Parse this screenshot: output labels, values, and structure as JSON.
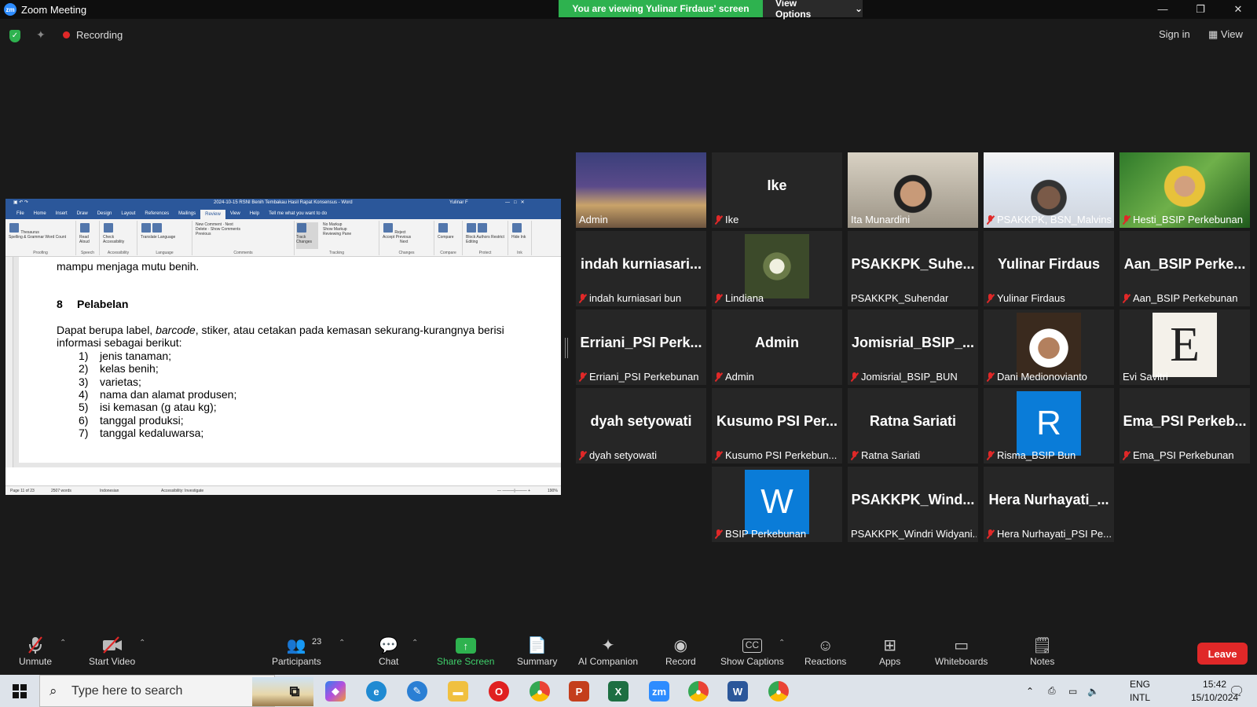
{
  "window": {
    "app_title": "Zoom Meeting",
    "viewing_banner": "You are viewing Yulinar Firdaus' screen",
    "view_options": "View Options",
    "recording": "Recording",
    "sign_in": "Sign in",
    "view": "View"
  },
  "shared_screen": {
    "doc_title": "2024-10-15 RSNI Benih Tembakau Hasil Rapat Konsensus  -  Word",
    "user": "Yulinar F",
    "tabs": [
      "File",
      "Home",
      "Insert",
      "Draw",
      "Design",
      "Layout",
      "References",
      "Mailings",
      "Review",
      "View",
      "Help",
      "Tell me what you want to do"
    ],
    "ribbon_groups": [
      "Proofing",
      "Speech",
      "Accessibility",
      "Language",
      "Comments",
      "Tracking",
      "Changes",
      "Compare",
      "Protect",
      "Ink"
    ],
    "ribbon_items": {
      "spelling": "Spelling & Grammar",
      "thesaurus": "Thesaurus",
      "word_count": "Word Count",
      "read_aloud": "Read Aloud",
      "check_access": "Check Accessibility",
      "translate": "Translate",
      "language": "Language",
      "new_comment": "New Comment",
      "delete": "Delete",
      "previous": "Previous",
      "next": "Next",
      "show_comments": "Show Comments",
      "track_changes": "Track Changes",
      "no_markup": "No Markup",
      "show_markup": "Show Markup",
      "reviewing_pane": "Reviewing Pane",
      "accept": "Accept",
      "reject": "Reject",
      "prev_change": "Previous",
      "next_change": "Next",
      "compare": "Compare",
      "block_authors": "Block Authors",
      "restrict_editing": "Restrict Editing",
      "hide_ink": "Hide Ink"
    },
    "body": {
      "line_top": "mampu menjaga mutu benih.",
      "heading_num": "8",
      "heading": "Pelabelan",
      "para_a": "Dapat berupa label, ",
      "para_b": "barcode",
      "para_c": ", stiker, atau cetakan pada kemasan sekurang-kurangnya berisi",
      "para_2": "informasi sebagai berikut:",
      "list": [
        {
          "n": "1)",
          "t": "jenis tanaman;"
        },
        {
          "n": "2)",
          "t": "kelas benih;"
        },
        {
          "n": "3)",
          "t": "varietas;"
        },
        {
          "n": "4)",
          "t": "nama dan alamat produsen;"
        },
        {
          "n": "5)",
          "t": "isi kemasan (g atau kg);"
        },
        {
          "n": "6)",
          "t": "tanggal produksi;"
        },
        {
          "n": "7)",
          "t": "tanggal kedaluwarsa;"
        }
      ]
    },
    "status": {
      "page": "Page 11 of 23",
      "words": "2507 words",
      "language": "Indonesian",
      "accessibility": "Accessibility: Investigate",
      "zoom": "190%"
    }
  },
  "gallery": [
    {
      "name": "Admin",
      "display": "",
      "muted": false,
      "kind": "photo-banner"
    },
    {
      "name": "Ike",
      "display": "Ike",
      "muted": true,
      "kind": "text"
    },
    {
      "name": "Ita Munardini",
      "display": "",
      "muted": false,
      "kind": "photo-person",
      "active": true
    },
    {
      "name": "PSAKKPK, BSN_Malvins",
      "display": "",
      "muted": true,
      "kind": "photo-bsn"
    },
    {
      "name": "Hesti_BSIP Perkebunan",
      "display": "",
      "muted": true,
      "kind": "photo-leaf"
    },
    {
      "name": "indah kurniasari bun",
      "display": "indah kurniasari...",
      "muted": true,
      "kind": "text"
    },
    {
      "name": "Lindiana",
      "display": "",
      "muted": true,
      "kind": "photo-forest"
    },
    {
      "name": "PSAKKPK_Suhendar",
      "display": "PSAKKPK_Suhe...",
      "muted": false,
      "kind": "text"
    },
    {
      "name": "Yulinar Firdaus",
      "display": "Yulinar Firdaus",
      "muted": true,
      "kind": "text"
    },
    {
      "name": "Aan_BSIP Perkebunan",
      "display": "Aan_BSIP Perke...",
      "muted": true,
      "kind": "text"
    },
    {
      "name": "Erriani_PSI Perkebunan",
      "display": "Erriani_PSI Perk...",
      "muted": true,
      "kind": "text"
    },
    {
      "name": "Admin",
      "display": "Admin",
      "muted": true,
      "kind": "text"
    },
    {
      "name": "Jomisrial_BSIP_BUN",
      "display": "Jomisrial_BSIP_...",
      "muted": true,
      "kind": "text"
    },
    {
      "name": "Dani Medionovianto",
      "display": "",
      "muted": true,
      "kind": "photo-man"
    },
    {
      "name": "Evi Savitri",
      "display": "",
      "muted": false,
      "kind": "photo-e"
    },
    {
      "name": "dyah setyowati",
      "display": "dyah setyowati",
      "muted": true,
      "kind": "text"
    },
    {
      "name": "Kusumo PSI Perkebun...",
      "display": "Kusumo PSI Per...",
      "muted": true,
      "kind": "text"
    },
    {
      "name": "Ratna Sariati",
      "display": "Ratna Sariati",
      "muted": true,
      "kind": "text"
    },
    {
      "name": "Risma_BSIP Bun",
      "display": "",
      "muted": true,
      "kind": "letter",
      "letter": "R",
      "color": "#0a7cd8"
    },
    {
      "name": "Ema_PSI Perkebunan",
      "display": "Ema_PSI Perkeb...",
      "muted": true,
      "kind": "text"
    },
    {
      "name": "BSIP Perkebunan",
      "display": "",
      "muted": true,
      "kind": "letter",
      "letter": "W",
      "color": "#0a7cd8"
    },
    {
      "name": "PSAKKPK_Windri Widyani...",
      "display": "PSAKKPK_Wind...",
      "muted": false,
      "kind": "text"
    },
    {
      "name": "Hera Nurhayati_PSI Pe...",
      "display": "Hera Nurhayati_...",
      "muted": true,
      "kind": "text"
    }
  ],
  "toolbar": {
    "unmute": "Unmute",
    "start_video": "Start Video",
    "participants": "Participants",
    "participants_count": "23",
    "chat": "Chat",
    "share_screen": "Share Screen",
    "summary": "Summary",
    "ai_companion": "AI Companion",
    "record": "Record",
    "show_captions": "Show Captions",
    "reactions": "Reactions",
    "apps": "Apps",
    "whiteboards": "Whiteboards",
    "notes": "Notes",
    "leave": "Leave"
  },
  "taskbar": {
    "search_placeholder": "Type here to search",
    "lang_top": "ENG",
    "lang_bottom": "INTL",
    "time": "15:42",
    "date": "15/10/2024"
  },
  "colors": {
    "banner_green": "#2eb24f",
    "leave_red": "#e02828",
    "active_speaker": "#d5e46a",
    "word_blue": "#2b579a"
  }
}
